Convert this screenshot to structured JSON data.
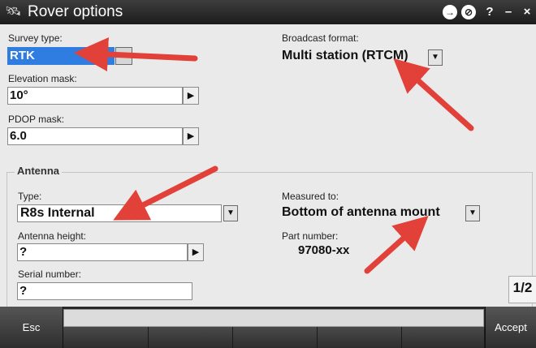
{
  "window": {
    "title": "Rover options",
    "app_icon": "satellite-icon",
    "controls": {
      "help": "?",
      "minimize": "–",
      "close": "×"
    }
  },
  "survey_type": {
    "label": "Survey type:",
    "value": "RTK"
  },
  "broadcast_format": {
    "label": "Broadcast format:",
    "value": "Multi station (RTCM)"
  },
  "elevation_mask": {
    "label": "Elevation mask:",
    "value": "10°"
  },
  "pdop_mask": {
    "label": "PDOP mask:",
    "value": "6.0"
  },
  "antenna": {
    "group_title": "Antenna",
    "type": {
      "label": "Type:",
      "value": "R8s Internal"
    },
    "measured_to": {
      "label": "Measured to:",
      "value": "Bottom of antenna mount"
    },
    "antenna_height": {
      "label": "Antenna height:",
      "value": "?"
    },
    "part_number": {
      "label": "Part number:",
      "value": "97080-xx"
    },
    "serial_number": {
      "label": "Serial number:",
      "value": "?"
    }
  },
  "page_indicator": "1/2",
  "softkeys": {
    "esc": "Esc",
    "accept": "Accept"
  },
  "colors": {
    "selection": "#2f7de0",
    "annotation_arrow": "#e2413a",
    "title_bar": "#2a2a2a"
  }
}
